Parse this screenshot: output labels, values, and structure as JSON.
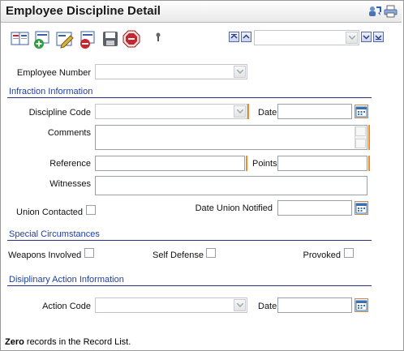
{
  "window": {
    "title": "Employee Discipline Detail"
  },
  "titlebar_icons": [
    "refresh-users-icon",
    "print-icon"
  ],
  "toolbar": {
    "buttons": [
      "add-record-icon",
      "new-record-icon",
      "edit-record-icon",
      "delete-record-icon",
      "save-icon",
      "stop-icon",
      "pin-icon"
    ],
    "nav": [
      "first-record-icon",
      "previous-record-icon",
      "next-record-icon",
      "last-record-icon"
    ],
    "record_selector_value": ""
  },
  "form": {
    "employee_number_label": "Employee Number",
    "employee_number_value": "",
    "infraction_section": "Infraction Information",
    "discipline_code_label": "Discipline Code",
    "discipline_code_value": "",
    "date_label": "Date",
    "date_value": "",
    "comments_label": "Comments",
    "comments_value": "",
    "reference_label": "Reference",
    "reference_value": "",
    "points_label": "Points",
    "points_value": "",
    "witnesses_label": "Witnesses",
    "witnesses_value": "",
    "union_contacted_label": "Union Contacted",
    "union_contacted_checked": false,
    "date_union_notified_label": "Date Union Notified",
    "date_union_notified_value": "",
    "special_section": "Special Circumstances",
    "weapons_involved_label": "Weapons Involved",
    "weapons_involved_checked": false,
    "self_defense_label": "Self Defense",
    "self_defense_checked": false,
    "provoked_label": "Provoked",
    "provoked_checked": false,
    "action_section": "Disiplinary Action Information",
    "action_code_label": "Action Code",
    "action_code_value": "",
    "action_date_label": "Date",
    "action_date_value": ""
  },
  "footer": {
    "count_bold": "Zero",
    "count_rest": " records in the Record List."
  },
  "colors": {
    "section_text": "#1d3fa4",
    "section_rule": "#2a2f88",
    "required_marker": "#f28c28"
  }
}
